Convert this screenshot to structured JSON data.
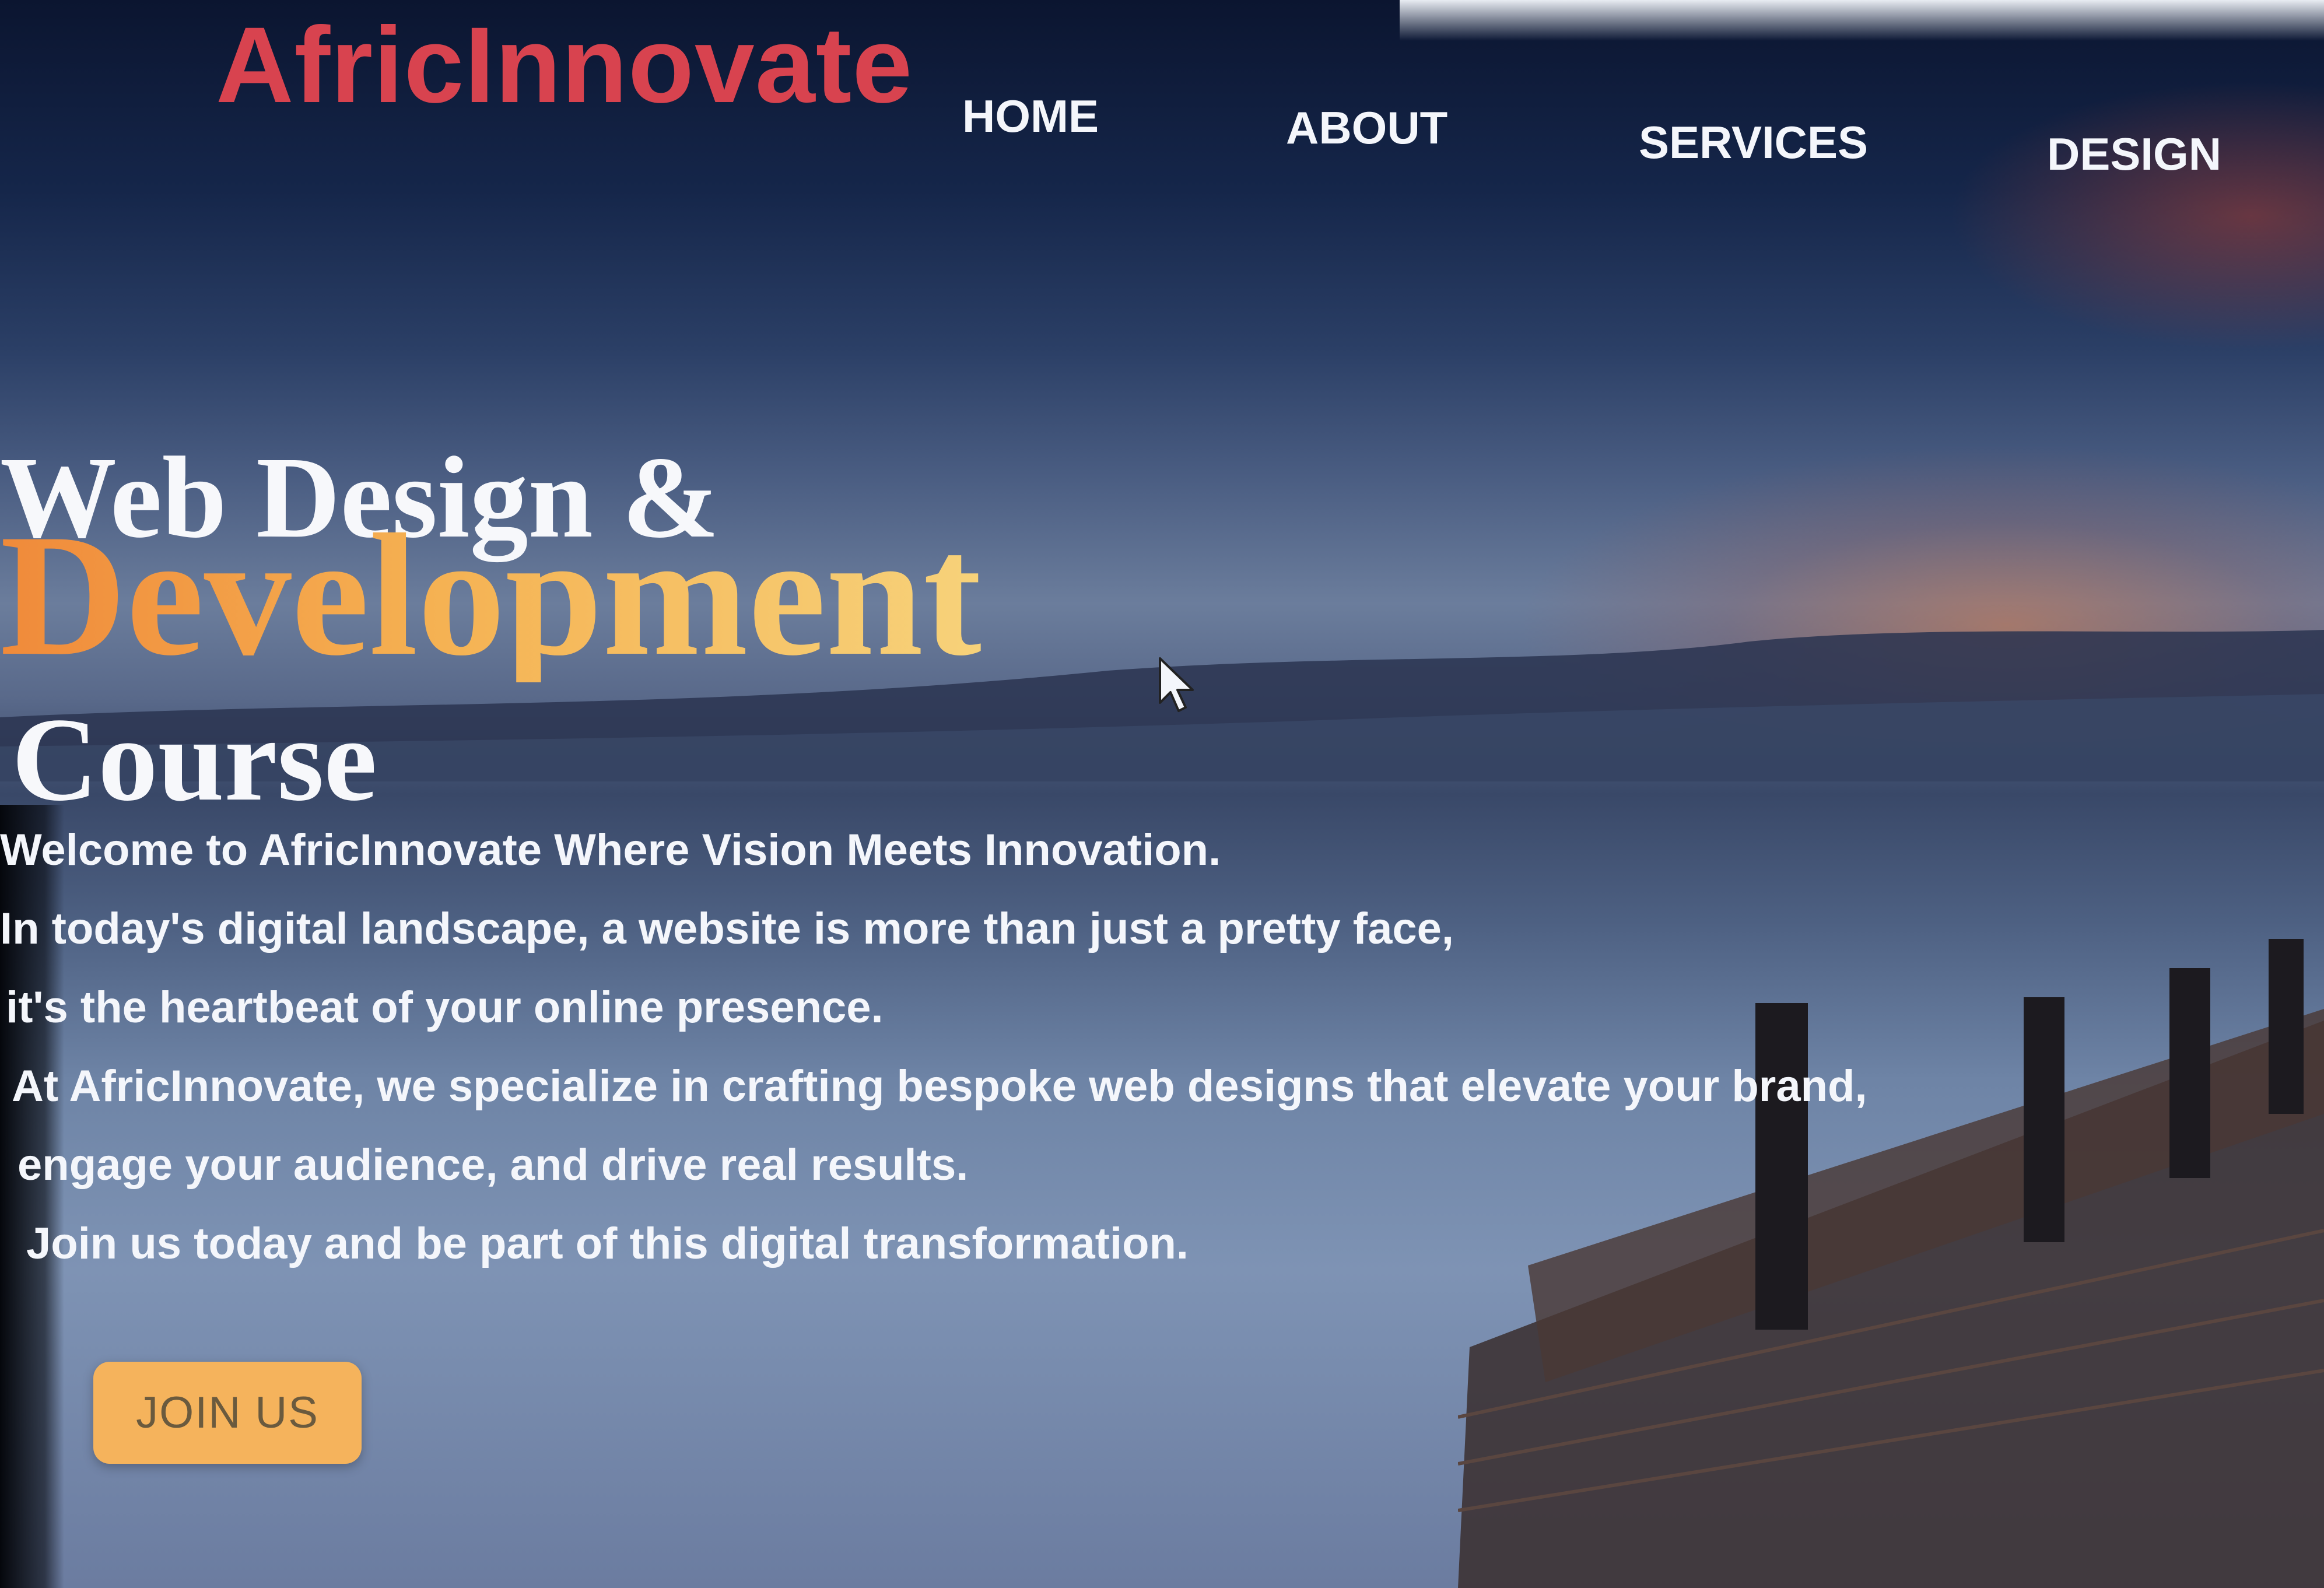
{
  "brand": {
    "logo_text": "AfricInnovate"
  },
  "nav": {
    "items": [
      {
        "label": "HOME"
      },
      {
        "label": "ABOUT"
      },
      {
        "label": "SERVICES"
      },
      {
        "label": "DESIGN"
      }
    ]
  },
  "hero": {
    "title_line1": "Web Design &",
    "title_line2": "Development",
    "title_line3": "Course",
    "intro_lines": [
      "Welcome to AfricInnovate Where Vision Meets Innovation.",
      "In today's digital landscape, a website is more than just a pretty face,",
      "it's the heartbeat of your online presence.",
      "At AfricInnovate, we specialize in crafting bespoke web designs that elevate your brand,",
      "engage your audience, and drive real results.",
      "Join us today and be part of this digital transformation."
    ],
    "cta_label": "JOIN US"
  },
  "colors": {
    "logo": "#d8434f",
    "accent_gradient_start": "#f08a3a",
    "accent_gradient_end": "#f7d27a",
    "button": "#f5b35c",
    "nav_text": "#f4f6fb"
  },
  "icons": {
    "cursor": "mouse-pointer-icon"
  }
}
